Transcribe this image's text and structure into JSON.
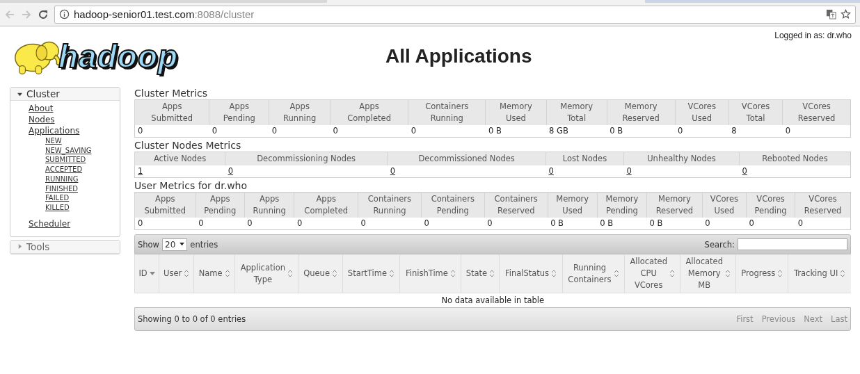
{
  "browser": {
    "url_host": "hadoop-senior01.test.com",
    "url_path": ":8088/cluster"
  },
  "header": {
    "logo_text": "hadoop",
    "title": "All Applications",
    "login": "Logged in as: dr.who"
  },
  "sidebar": [
    {
      "label": "Cluster",
      "expanded": true,
      "items": [
        {
          "label": "About"
        },
        {
          "label": "Nodes"
        },
        {
          "label": "Applications",
          "children": [
            {
              "label": "NEW"
            },
            {
              "label": "NEW_SAVING"
            },
            {
              "label": "SUBMITTED"
            },
            {
              "label": "ACCEPTED"
            },
            {
              "label": "RUNNING"
            },
            {
              "label": "FINISHED"
            },
            {
              "label": "FAILED"
            },
            {
              "label": "KILLED"
            }
          ]
        },
        {
          "label": "Scheduler"
        }
      ]
    },
    {
      "label": "Tools",
      "expanded": false
    }
  ],
  "metrics": [
    {
      "title": "Cluster Metrics",
      "columns": [
        "Apps\nSubmitted",
        "Apps\nPending",
        "Apps\nRunning",
        "Apps\nCompleted",
        "Containers\nRunning",
        "Memory\nUsed",
        "Memory\nTotal",
        "Memory\nReserved",
        "VCores\nUsed",
        "VCores\nTotal",
        "VCores\nReserved"
      ],
      "values": [
        {
          "text": "0",
          "link": false
        },
        {
          "text": "0",
          "link": false
        },
        {
          "text": "0",
          "link": false
        },
        {
          "text": "0",
          "link": false
        },
        {
          "text": "0",
          "link": false
        },
        {
          "text": "0 B",
          "link": false
        },
        {
          "text": "8 GB",
          "link": false
        },
        {
          "text": "0 B",
          "link": false
        },
        {
          "text": "0",
          "link": false
        },
        {
          "text": "8",
          "link": false
        },
        {
          "text": "0",
          "link": false
        }
      ]
    },
    {
      "title": "Cluster Nodes Metrics",
      "columns": [
        "Active Nodes",
        "Decommissioning Nodes",
        "Decommissioned Nodes",
        "Lost Nodes",
        "Unhealthy Nodes",
        "Rebooted Nodes"
      ],
      "values": [
        {
          "text": "1",
          "link": true
        },
        {
          "text": "0",
          "link": true
        },
        {
          "text": "0",
          "link": true
        },
        {
          "text": "0",
          "link": true
        },
        {
          "text": "0",
          "link": true
        },
        {
          "text": "0",
          "link": true
        }
      ]
    },
    {
      "title": "User Metrics for dr.who",
      "columns": [
        "Apps\nSubmitted",
        "Apps\nPending",
        "Apps\nRunning",
        "Apps\nCompleted",
        "Containers\nRunning",
        "Containers\nPending",
        "Containers\nReserved",
        "Memory\nUsed",
        "Memory\nPending",
        "Memory\nReserved",
        "VCores\nUsed",
        "VCores\nPending",
        "VCores\nReserved"
      ],
      "values": [
        {
          "text": "0",
          "link": false
        },
        {
          "text": "0",
          "link": false
        },
        {
          "text": "0",
          "link": false
        },
        {
          "text": "0",
          "link": false
        },
        {
          "text": "0",
          "link": false
        },
        {
          "text": "0",
          "link": false
        },
        {
          "text": "0",
          "link": false
        },
        {
          "text": "0 B",
          "link": false
        },
        {
          "text": "0 B",
          "link": false
        },
        {
          "text": "0 B",
          "link": false
        },
        {
          "text": "0",
          "link": false
        },
        {
          "text": "0",
          "link": false
        },
        {
          "text": "0",
          "link": false
        }
      ]
    }
  ],
  "apps": {
    "show_label": "Show",
    "page_size": "20",
    "entries_label": "entries",
    "search_label": "Search:",
    "columns": [
      {
        "label": "ID",
        "sorted": true
      },
      {
        "label": "User",
        "sorted": false
      },
      {
        "label": "Name",
        "sorted": false
      },
      {
        "label": "Application\nType",
        "sorted": false
      },
      {
        "label": "Queue",
        "sorted": false
      },
      {
        "label": "StartTime",
        "sorted": false
      },
      {
        "label": "FinishTime",
        "sorted": false
      },
      {
        "label": "State",
        "sorted": false
      },
      {
        "label": "FinalStatus",
        "sorted": false
      },
      {
        "label": "Running\nContainers",
        "sorted": false
      },
      {
        "label": "Allocated\nCPU\nVCores",
        "sorted": false
      },
      {
        "label": "Allocated\nMemory\nMB",
        "sorted": false
      },
      {
        "label": "Progress",
        "sorted": false
      },
      {
        "label": "Tracking UI",
        "sorted": false
      }
    ],
    "empty_text": "No data available in table",
    "info": "Showing 0 to 0 of 0 entries",
    "pager": [
      {
        "label": "First",
        "disabled": true
      },
      {
        "label": "Previous",
        "disabled": true
      },
      {
        "label": "Next",
        "disabled": true
      },
      {
        "label": "Last",
        "disabled": true
      }
    ]
  }
}
